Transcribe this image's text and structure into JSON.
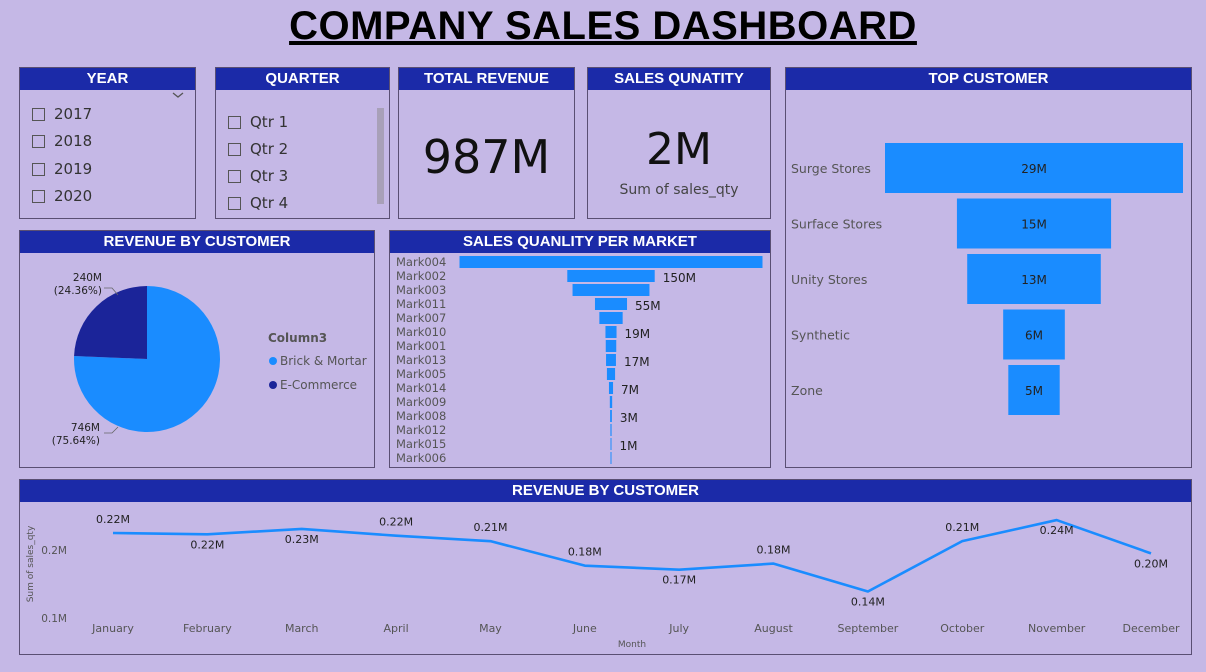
{
  "title": "COMPANY SALES DASHBOARD",
  "year_slicer": {
    "header": "YEAR",
    "items": [
      "2017",
      "2018",
      "2019",
      "2020"
    ]
  },
  "quarter_slicer": {
    "header": "QUARTER",
    "items": [
      "Qtr 1",
      "Qtr 2",
      "Qtr 3",
      "Qtr 4"
    ]
  },
  "total_revenue": {
    "header": "TOTAL REVENUE",
    "value": "987M"
  },
  "sales_quantity": {
    "header": "SALES QUNATITY",
    "value": "2M",
    "subtitle": "Sum of sales_qty"
  },
  "top_customer": {
    "header": "TOP CUSTOMER",
    "items": [
      {
        "label": "Surge Stores",
        "value": 29,
        "text": "29M"
      },
      {
        "label": "Surface Stores",
        "value": 15,
        "text": "15M"
      },
      {
        "label": "Unity Stores",
        "value": 13,
        "text": "13M"
      },
      {
        "label": "Synthetic",
        "value": 6,
        "text": "6M"
      },
      {
        "label": "Zone",
        "value": 5,
        "text": "5M"
      }
    ]
  },
  "revenue_pie": {
    "header": "REVENUE BY CUSTOMER",
    "legend_title": "Column3",
    "colors": {
      "brick": "#1a8cff",
      "ecommerce": "#1b2499"
    },
    "slices": [
      {
        "name": "Brick & Mortar",
        "value": 746,
        "label": "746M",
        "pct": "(75.64%)"
      },
      {
        "name": "E-Commerce",
        "value": 240,
        "label": "240M",
        "pct": "(24.36%)"
      }
    ]
  },
  "market_chart": {
    "header": "SALES QUANLITY PER MARKET",
    "items": [
      {
        "label": "Mark004",
        "value": 520,
        "text": ""
      },
      {
        "label": "Mark002",
        "value": 150,
        "text": "150M"
      },
      {
        "label": "Mark003",
        "value": 132,
        "text": ""
      },
      {
        "label": "Mark011",
        "value": 55,
        "text": "55M"
      },
      {
        "label": "Mark007",
        "value": 40,
        "text": ""
      },
      {
        "label": "Mark010",
        "value": 19,
        "text": "19M"
      },
      {
        "label": "Mark001",
        "value": 18,
        "text": ""
      },
      {
        "label": "Mark013",
        "value": 17,
        "text": "17M"
      },
      {
        "label": "Mark005",
        "value": 14,
        "text": ""
      },
      {
        "label": "Mark014",
        "value": 7,
        "text": "7M"
      },
      {
        "label": "Mark009",
        "value": 4,
        "text": ""
      },
      {
        "label": "Mark008",
        "value": 3,
        "text": "3M"
      },
      {
        "label": "Mark012",
        "value": 2,
        "text": ""
      },
      {
        "label": "Mark015",
        "value": 1,
        "text": "1M"
      },
      {
        "label": "Mark006",
        "value": 0.5,
        "text": ""
      }
    ]
  },
  "chart_data": {
    "type": "line",
    "title": "REVENUE BY CUSTOMER",
    "xlabel": "Month",
    "ylabel": "Sum of sales_qty",
    "categories": [
      "January",
      "February",
      "March",
      "April",
      "May",
      "June",
      "July",
      "August",
      "September",
      "October",
      "November",
      "December"
    ],
    "values": [
      0.225,
      0.223,
      0.231,
      0.221,
      0.213,
      0.177,
      0.171,
      0.18,
      0.139,
      0.213,
      0.244,
      0.195
    ],
    "labels": [
      "0.22M",
      "0.22M",
      "0.23M",
      "0.22M",
      "0.21M",
      "0.18M",
      "0.17M",
      "0.18M",
      "0.14M",
      "0.21M",
      "0.24M",
      "0.20M"
    ],
    "yticks": [
      "0.2M",
      "0.1M"
    ],
    "ylim": [
      0.1,
      0.25
    ],
    "line_color": "#1a8cff"
  }
}
